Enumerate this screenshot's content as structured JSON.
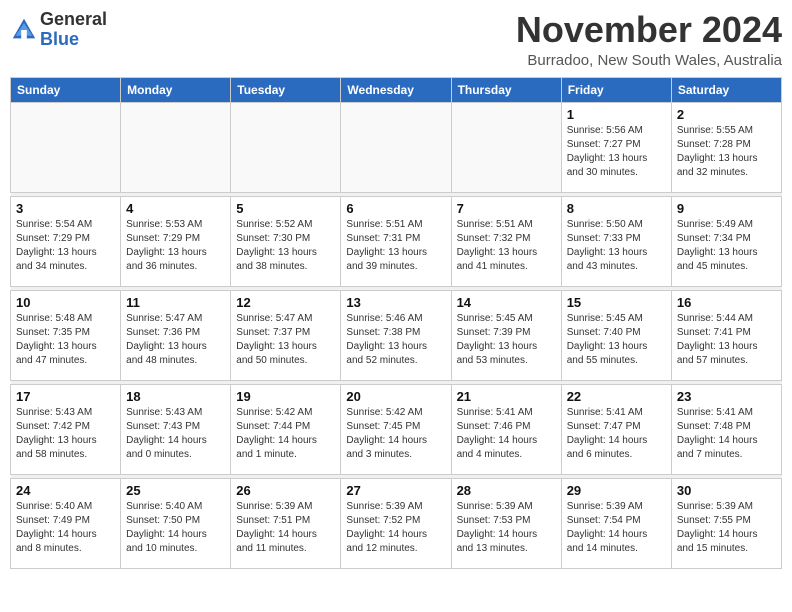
{
  "header": {
    "logo_general": "General",
    "logo_blue": "Blue",
    "month_title": "November 2024",
    "location": "Burradoo, New South Wales, Australia"
  },
  "calendar": {
    "days_of_week": [
      "Sunday",
      "Monday",
      "Tuesday",
      "Wednesday",
      "Thursday",
      "Friday",
      "Saturday"
    ],
    "weeks": [
      [
        {
          "day": "",
          "info": ""
        },
        {
          "day": "",
          "info": ""
        },
        {
          "day": "",
          "info": ""
        },
        {
          "day": "",
          "info": ""
        },
        {
          "day": "",
          "info": ""
        },
        {
          "day": "1",
          "info": "Sunrise: 5:56 AM\nSunset: 7:27 PM\nDaylight: 13 hours\nand 30 minutes."
        },
        {
          "day": "2",
          "info": "Sunrise: 5:55 AM\nSunset: 7:28 PM\nDaylight: 13 hours\nand 32 minutes."
        }
      ],
      [
        {
          "day": "3",
          "info": "Sunrise: 5:54 AM\nSunset: 7:29 PM\nDaylight: 13 hours\nand 34 minutes."
        },
        {
          "day": "4",
          "info": "Sunrise: 5:53 AM\nSunset: 7:29 PM\nDaylight: 13 hours\nand 36 minutes."
        },
        {
          "day": "5",
          "info": "Sunrise: 5:52 AM\nSunset: 7:30 PM\nDaylight: 13 hours\nand 38 minutes."
        },
        {
          "day": "6",
          "info": "Sunrise: 5:51 AM\nSunset: 7:31 PM\nDaylight: 13 hours\nand 39 minutes."
        },
        {
          "day": "7",
          "info": "Sunrise: 5:51 AM\nSunset: 7:32 PM\nDaylight: 13 hours\nand 41 minutes."
        },
        {
          "day": "8",
          "info": "Sunrise: 5:50 AM\nSunset: 7:33 PM\nDaylight: 13 hours\nand 43 minutes."
        },
        {
          "day": "9",
          "info": "Sunrise: 5:49 AM\nSunset: 7:34 PM\nDaylight: 13 hours\nand 45 minutes."
        }
      ],
      [
        {
          "day": "10",
          "info": "Sunrise: 5:48 AM\nSunset: 7:35 PM\nDaylight: 13 hours\nand 47 minutes."
        },
        {
          "day": "11",
          "info": "Sunrise: 5:47 AM\nSunset: 7:36 PM\nDaylight: 13 hours\nand 48 minutes."
        },
        {
          "day": "12",
          "info": "Sunrise: 5:47 AM\nSunset: 7:37 PM\nDaylight: 13 hours\nand 50 minutes."
        },
        {
          "day": "13",
          "info": "Sunrise: 5:46 AM\nSunset: 7:38 PM\nDaylight: 13 hours\nand 52 minutes."
        },
        {
          "day": "14",
          "info": "Sunrise: 5:45 AM\nSunset: 7:39 PM\nDaylight: 13 hours\nand 53 minutes."
        },
        {
          "day": "15",
          "info": "Sunrise: 5:45 AM\nSunset: 7:40 PM\nDaylight: 13 hours\nand 55 minutes."
        },
        {
          "day": "16",
          "info": "Sunrise: 5:44 AM\nSunset: 7:41 PM\nDaylight: 13 hours\nand 57 minutes."
        }
      ],
      [
        {
          "day": "17",
          "info": "Sunrise: 5:43 AM\nSunset: 7:42 PM\nDaylight: 13 hours\nand 58 minutes."
        },
        {
          "day": "18",
          "info": "Sunrise: 5:43 AM\nSunset: 7:43 PM\nDaylight: 14 hours\nand 0 minutes."
        },
        {
          "day": "19",
          "info": "Sunrise: 5:42 AM\nSunset: 7:44 PM\nDaylight: 14 hours\nand 1 minute."
        },
        {
          "day": "20",
          "info": "Sunrise: 5:42 AM\nSunset: 7:45 PM\nDaylight: 14 hours\nand 3 minutes."
        },
        {
          "day": "21",
          "info": "Sunrise: 5:41 AM\nSunset: 7:46 PM\nDaylight: 14 hours\nand 4 minutes."
        },
        {
          "day": "22",
          "info": "Sunrise: 5:41 AM\nSunset: 7:47 PM\nDaylight: 14 hours\nand 6 minutes."
        },
        {
          "day": "23",
          "info": "Sunrise: 5:41 AM\nSunset: 7:48 PM\nDaylight: 14 hours\nand 7 minutes."
        }
      ],
      [
        {
          "day": "24",
          "info": "Sunrise: 5:40 AM\nSunset: 7:49 PM\nDaylight: 14 hours\nand 8 minutes."
        },
        {
          "day": "25",
          "info": "Sunrise: 5:40 AM\nSunset: 7:50 PM\nDaylight: 14 hours\nand 10 minutes."
        },
        {
          "day": "26",
          "info": "Sunrise: 5:39 AM\nSunset: 7:51 PM\nDaylight: 14 hours\nand 11 minutes."
        },
        {
          "day": "27",
          "info": "Sunrise: 5:39 AM\nSunset: 7:52 PM\nDaylight: 14 hours\nand 12 minutes."
        },
        {
          "day": "28",
          "info": "Sunrise: 5:39 AM\nSunset: 7:53 PM\nDaylight: 14 hours\nand 13 minutes."
        },
        {
          "day": "29",
          "info": "Sunrise: 5:39 AM\nSunset: 7:54 PM\nDaylight: 14 hours\nand 14 minutes."
        },
        {
          "day": "30",
          "info": "Sunrise: 5:39 AM\nSunset: 7:55 PM\nDaylight: 14 hours\nand 15 minutes."
        }
      ]
    ]
  }
}
